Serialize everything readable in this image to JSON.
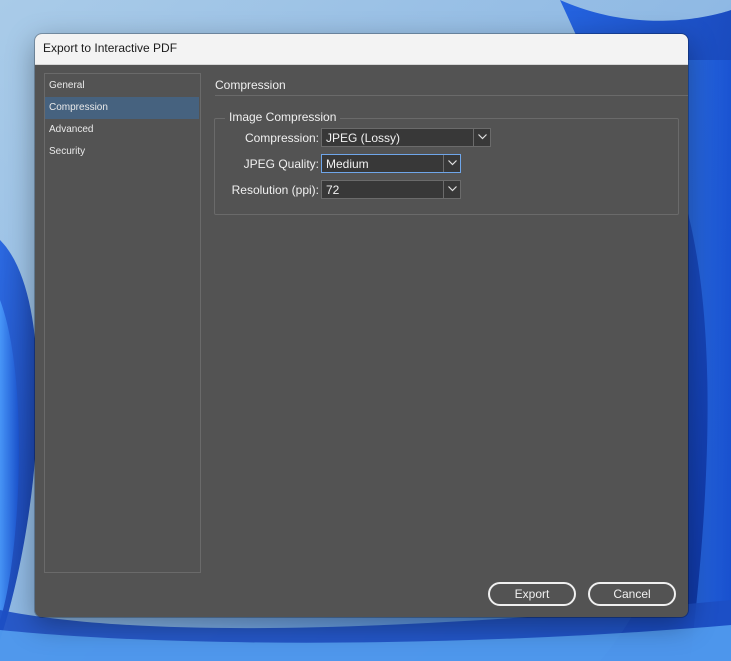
{
  "window": {
    "title": "Export to Interactive PDF"
  },
  "sidebar": {
    "items": [
      {
        "label": "General",
        "active": false
      },
      {
        "label": "Compression",
        "active": true
      },
      {
        "label": "Advanced",
        "active": false
      },
      {
        "label": "Security",
        "active": false
      }
    ]
  },
  "section": {
    "title": "Compression"
  },
  "image_compression": {
    "group_label": "Image Compression",
    "compression": {
      "label": "Compression:",
      "value": "JPEG (Lossy)"
    },
    "jpeg_quality": {
      "label": "JPEG Quality:",
      "value": "Medium"
    },
    "resolution": {
      "label": "Resolution (ppi):",
      "value": "72"
    }
  },
  "buttons": {
    "export": "Export",
    "cancel": "Cancel"
  },
  "colors": {
    "dialog_bg": "#535353",
    "selection": "#46627f",
    "focus": "#6fa6ea"
  }
}
